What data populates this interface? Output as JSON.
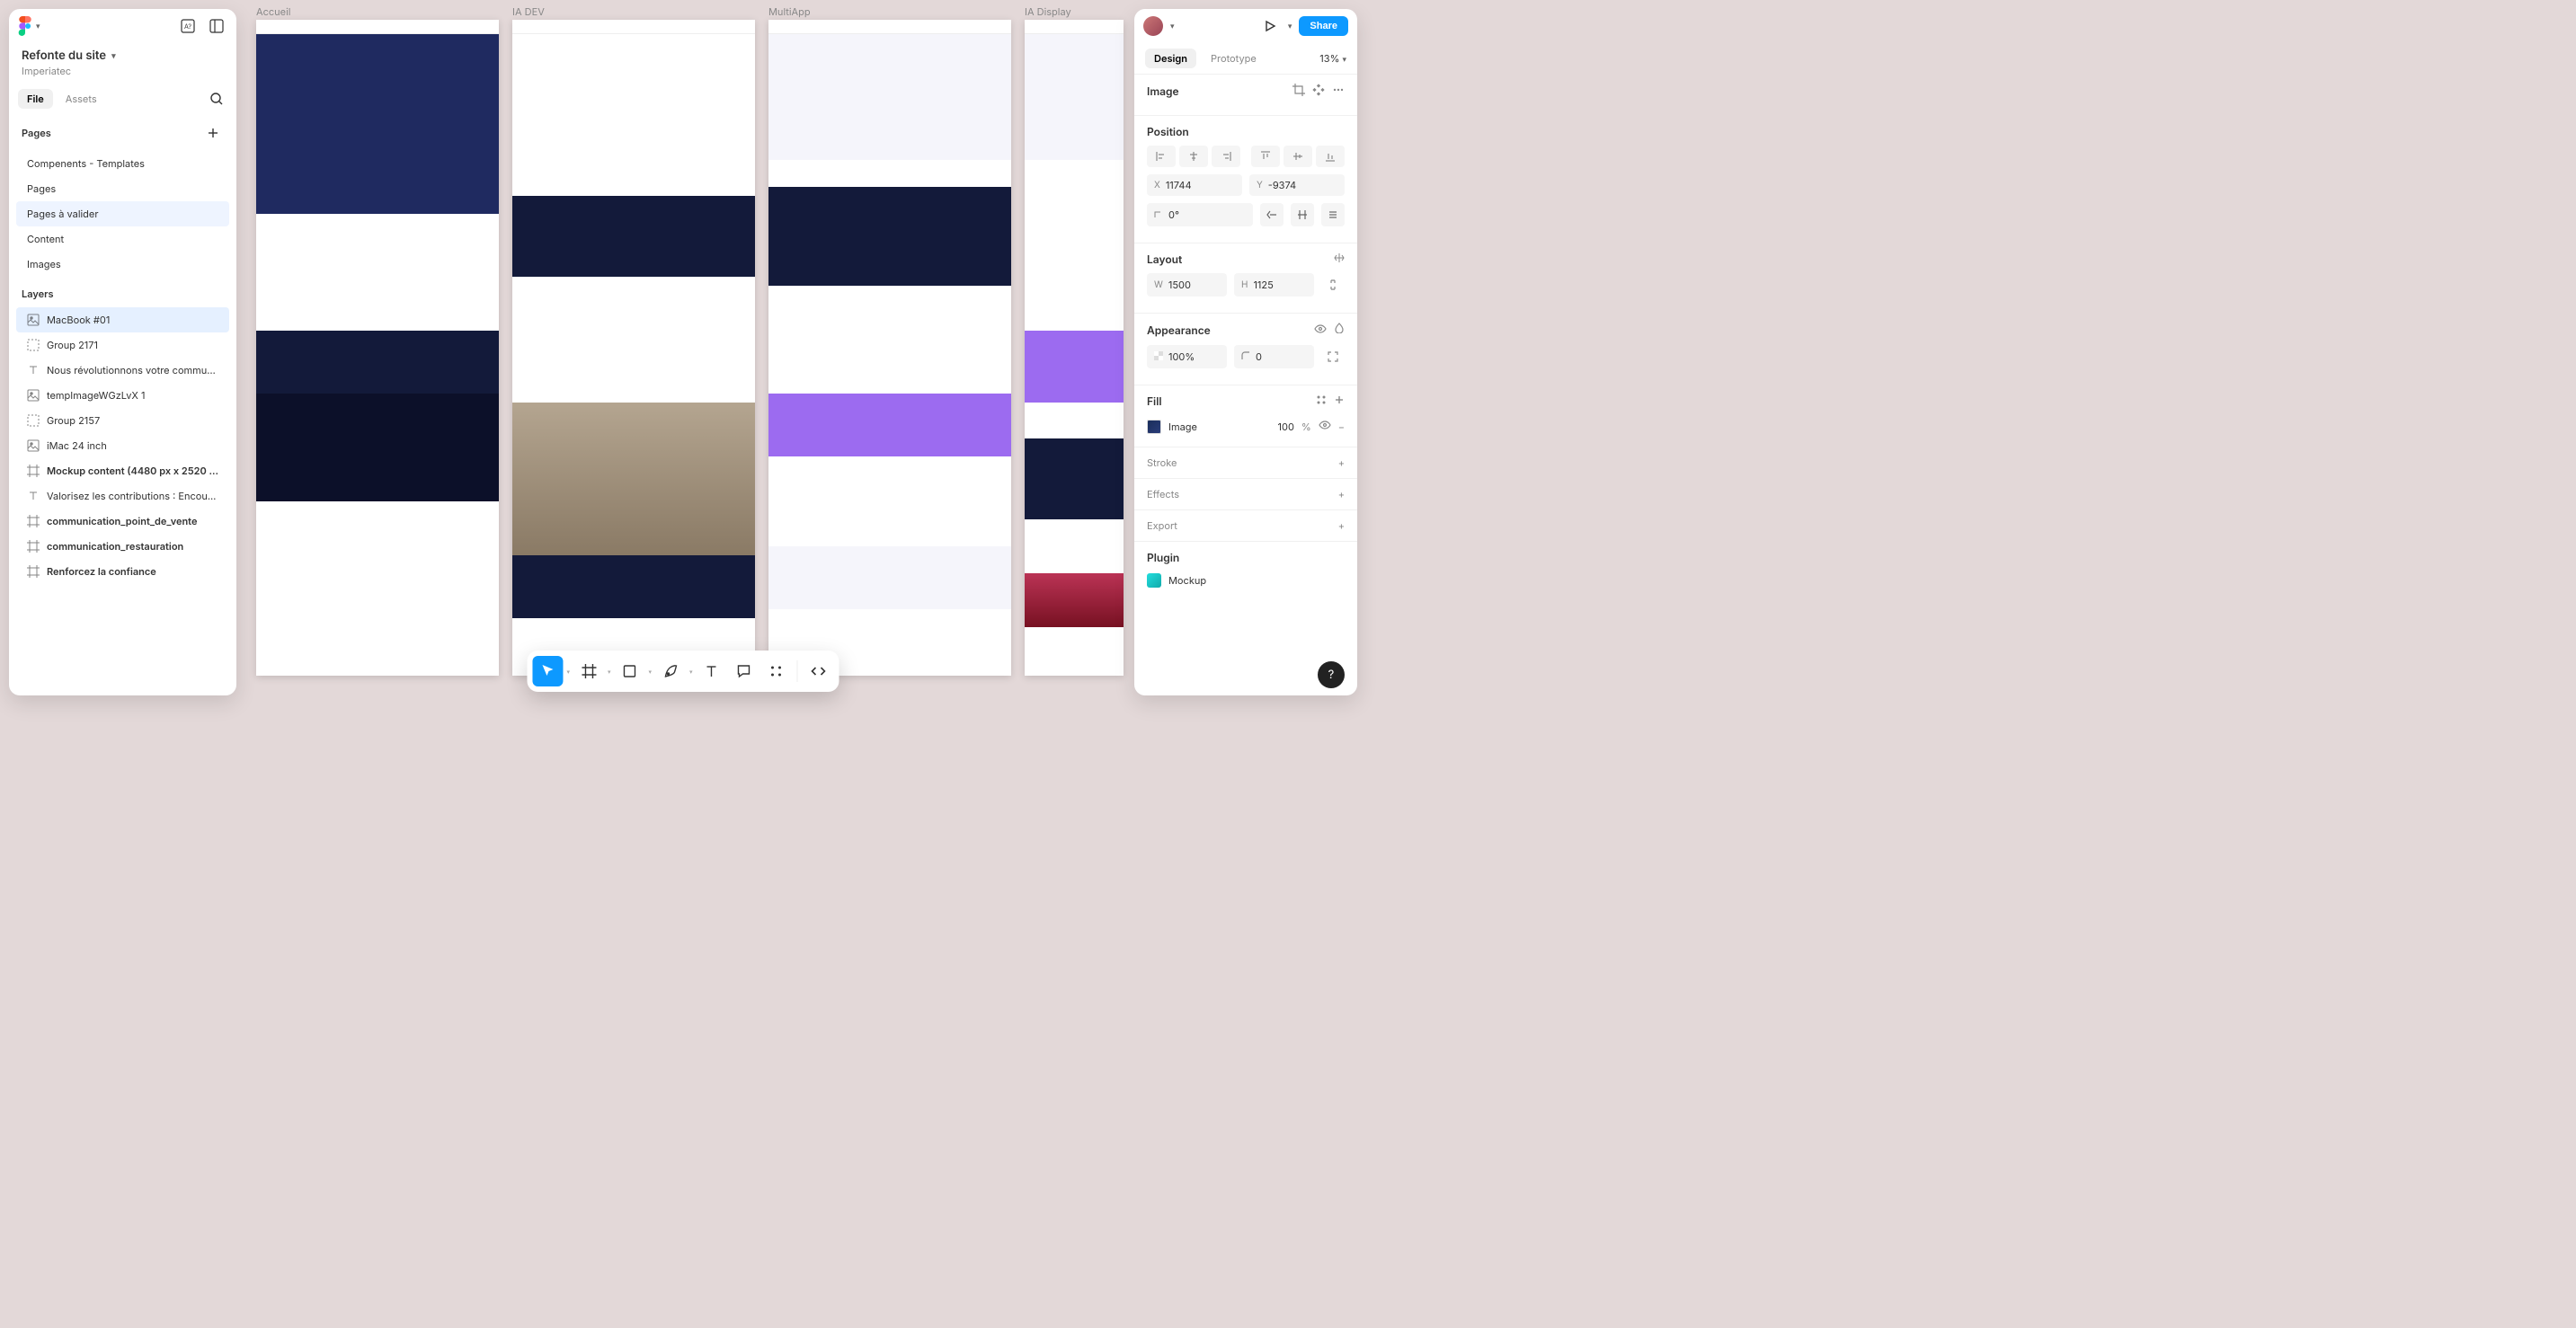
{
  "file": {
    "title": "Refonte du site",
    "team": "Imperiatec"
  },
  "leftTabs": {
    "file": "File",
    "assets": "Assets"
  },
  "pages": {
    "header": "Pages",
    "items": [
      {
        "label": "Compenents - Templates"
      },
      {
        "label": "Pages"
      },
      {
        "label": "Pages à valider",
        "active": true
      },
      {
        "label": "Content"
      },
      {
        "label": "Images"
      }
    ]
  },
  "layers": {
    "header": "Layers",
    "items": [
      {
        "label": "MacBook #01",
        "icon": "image",
        "selected": true
      },
      {
        "label": "Group 2171",
        "icon": "group"
      },
      {
        "label": "Nous révolutionnons votre commu…",
        "icon": "text"
      },
      {
        "label": "tempImageWGzLvX 1",
        "icon": "image"
      },
      {
        "label": "Group 2157",
        "icon": "group"
      },
      {
        "label": "iMac 24 inch",
        "icon": "image"
      },
      {
        "label": "Mockup content (4480 px x 2520 …",
        "icon": "frame",
        "bold": true
      },
      {
        "label": "Valorisez les contributions : Encou…",
        "icon": "text"
      },
      {
        "label": "communication_point_de_vente",
        "icon": "frame",
        "bold": true
      },
      {
        "label": "communication_restauration",
        "icon": "frame",
        "bold": true
      },
      {
        "label": "Renforcez la confiance",
        "icon": "frame",
        "bold": true
      }
    ]
  },
  "canvas": {
    "frames": [
      {
        "name": "Accueil"
      },
      {
        "name": "IA DEV"
      },
      {
        "name": "MultiApp"
      },
      {
        "name": "IA Display"
      }
    ]
  },
  "right": {
    "share": "Share",
    "tabs": {
      "design": "Design",
      "prototype": "Prototype"
    },
    "zoom": "13%",
    "selection": "Image",
    "position": {
      "header": "Position",
      "x": "11744",
      "y": "-9374",
      "rotation": "0°"
    },
    "layout": {
      "header": "Layout",
      "w": "1500",
      "h": "1125"
    },
    "appearance": {
      "header": "Appearance",
      "opacity": "100%",
      "radius": "0"
    },
    "fill": {
      "header": "Fill",
      "type": "Image",
      "opacity": "100",
      "unit": "%"
    },
    "stroke": "Stroke",
    "effects": "Effects",
    "export": "Export",
    "plugin": "Plugin",
    "plugin_item": "Mockup"
  }
}
